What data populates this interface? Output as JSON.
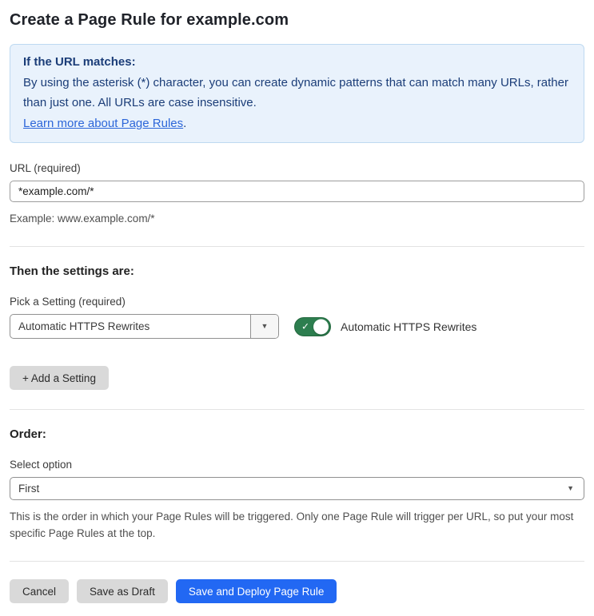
{
  "page": {
    "title": "Create a Page Rule for example.com"
  },
  "info_box": {
    "heading": "If the URL matches:",
    "body": "By using the asterisk (*) character, you can create dynamic patterns that can match many URLs, rather than just one. All URLs are case insensitive.",
    "link_label": "Learn more about Page Rules",
    "link_suffix": "."
  },
  "url_field": {
    "label": "URL (required)",
    "value": "*example.com/*",
    "example": "Example: www.example.com/*"
  },
  "settings_section": {
    "heading": "Then the settings are:",
    "picker_label": "Pick a Setting (required)",
    "picker_value": "Automatic HTTPS Rewrites",
    "toggle": {
      "state": "on",
      "label": "Automatic HTTPS Rewrites",
      "check_icon": "✓"
    },
    "caret_icon": "▼",
    "add_setting_label": "+ Add a Setting"
  },
  "order_section": {
    "heading": "Order:",
    "select_label": "Select option",
    "select_value": "First",
    "caret_icon": "▼",
    "help": "This is the order in which your Page Rules will be triggered. Only one Page Rule will trigger per URL, so put your most specific Page Rules at the top."
  },
  "footer": {
    "cancel_label": "Cancel",
    "save_draft_label": "Save as Draft",
    "save_deploy_label": "Save and Deploy Page Rule"
  },
  "colors": {
    "accent_blue": "#2268f3",
    "info_bg": "#e9f2fc",
    "info_border": "#bed9f1",
    "info_text": "#1b3d78",
    "link_blue": "#2c66d9",
    "toggle_green": "#2d7e4f",
    "button_gray": "#d9d9d9",
    "divider_gray": "#e3e3e3"
  }
}
